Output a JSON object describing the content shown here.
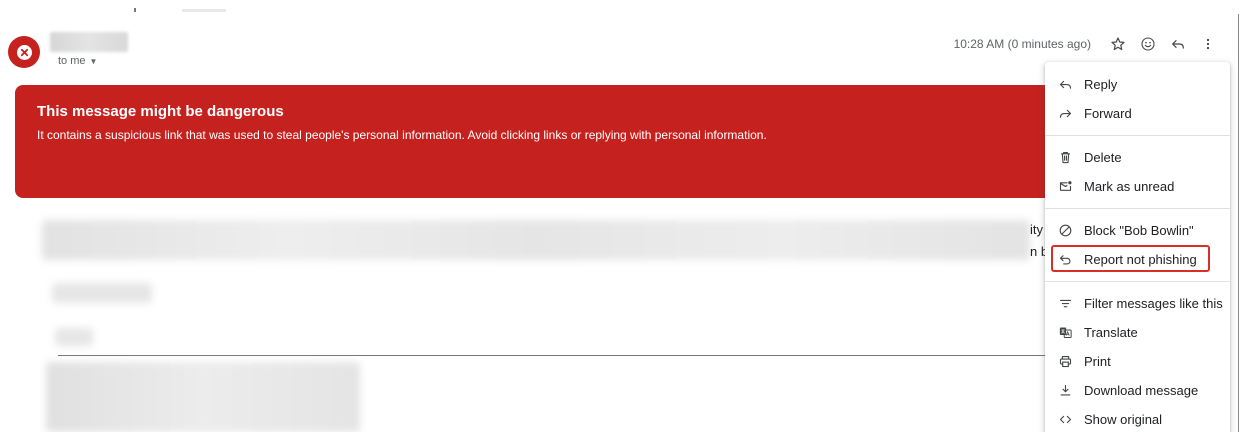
{
  "header": {
    "recipient_label": "to me",
    "timestamp": "10:28 AM (0 minutes ago)",
    "icons": [
      "star-icon",
      "emoji-icon",
      "reply-icon",
      "more-vert-icon"
    ]
  },
  "banner": {
    "title": "This message might be dangerous",
    "text": "It contains a suspicious link that was used to steal people's personal information. Avoid clicking links or replying with personal information.",
    "color": "#c5221f"
  },
  "body_peek": {
    "line1": "ity",
    "line2": "n b"
  },
  "menu": {
    "reply": "Reply",
    "forward": "Forward",
    "delete": "Delete",
    "mark_unread": "Mark as unread",
    "block": "Block \"Bob Bowlin\"",
    "report_not_phishing": "Report not phishing",
    "filter": "Filter messages like this",
    "translate": "Translate",
    "print": "Print",
    "download": "Download message",
    "show_original": "Show original"
  },
  "colors": {
    "danger": "#c5221f",
    "highlight": "#d93025",
    "icon": "#444746"
  }
}
